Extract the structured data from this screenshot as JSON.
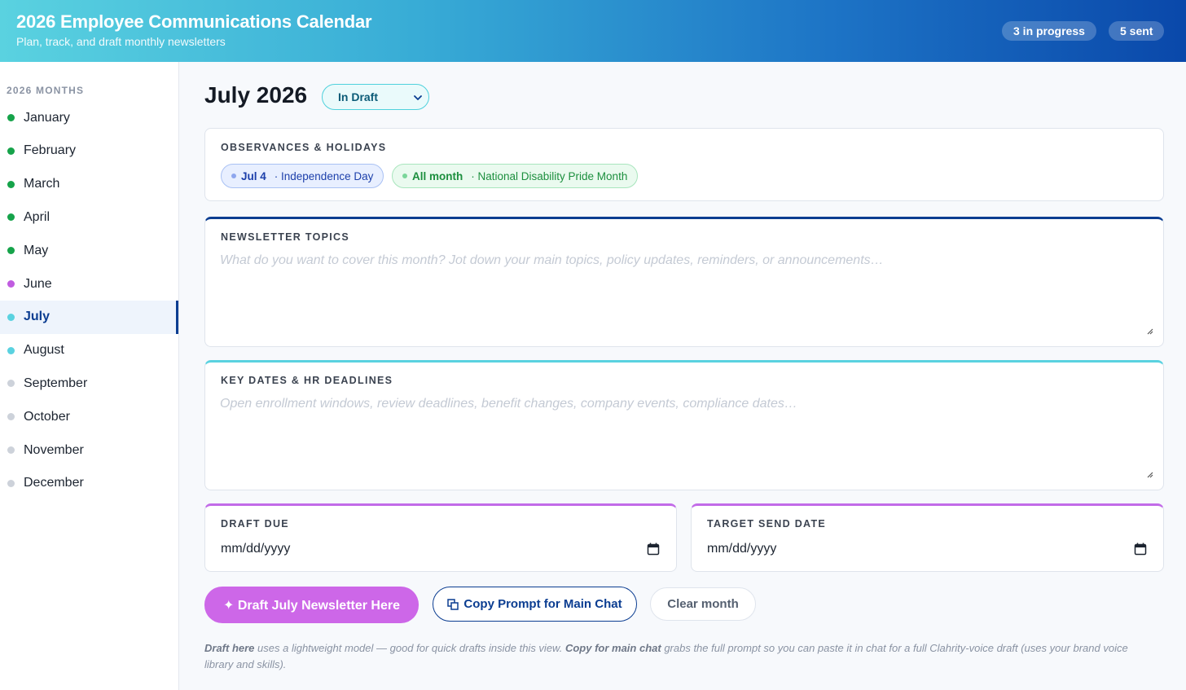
{
  "header": {
    "title": "2026 Employee Communications Calendar",
    "subtitle": "Plan, track, and draft monthly newsletters",
    "badges": {
      "in_progress": "3 in progress",
      "sent": "5 sent"
    }
  },
  "sidebar": {
    "heading": "2026 MONTHS",
    "months": [
      {
        "label": "January",
        "dot_color": "#16a34a"
      },
      {
        "label": "February",
        "dot_color": "#16a34a"
      },
      {
        "label": "March",
        "dot_color": "#16a34a"
      },
      {
        "label": "April",
        "dot_color": "#16a34a"
      },
      {
        "label": "May",
        "dot_color": "#16a34a"
      },
      {
        "label": "June",
        "dot_color": "#c05ce0"
      },
      {
        "label": "July",
        "dot_color": "#5ad2e0",
        "active": true
      },
      {
        "label": "August",
        "dot_color": "#5ad2e0"
      },
      {
        "label": "September",
        "dot_color": "#cdd2da"
      },
      {
        "label": "October",
        "dot_color": "#cdd2da"
      },
      {
        "label": "November",
        "dot_color": "#cdd2da"
      },
      {
        "label": "December",
        "dot_color": "#cdd2da"
      }
    ]
  },
  "main": {
    "title": "July 2026",
    "status": "In Draft",
    "observances": {
      "label": "OBSERVANCES & HOLIDAYS",
      "items": [
        {
          "when": "Jul 4",
          "name": "· Independence Day"
        },
        {
          "when": "All month",
          "name": "· National Disability Pride Month"
        }
      ]
    },
    "topics": {
      "label": "NEWSLETTER TOPICS",
      "placeholder": "What do you want to cover this month? Jot down your main topics, policy updates, reminders, or announcements…"
    },
    "key_dates": {
      "label": "KEY DATES & HR DEADLINES",
      "placeholder": "Open enrollment windows, review deadlines, benefit changes, company events, compliance dates…"
    },
    "draft_due": {
      "label": "DRAFT DUE",
      "value": "mm/dd/yyyy"
    },
    "target_send": {
      "label": "TARGET SEND DATE",
      "value": "mm/dd/yyyy"
    },
    "buttons": {
      "draft": "✦ Draft July Newsletter Here",
      "copy": "Copy Prompt for Main Chat",
      "clear": "Clear month"
    },
    "note": {
      "bold1": "Draft here",
      "text1": " uses a lightweight model — good for quick drafts inside this view. ",
      "bold2": "Copy for main chat",
      "text2": " grabs the full prompt so you can paste it in chat for a full Clahrity-voice draft (uses your brand voice library and skills)."
    }
  },
  "colors": {
    "accent_navy": "#0b3d91",
    "accent_cyan": "#5ad2e0",
    "accent_purple": "#cd67e8"
  }
}
